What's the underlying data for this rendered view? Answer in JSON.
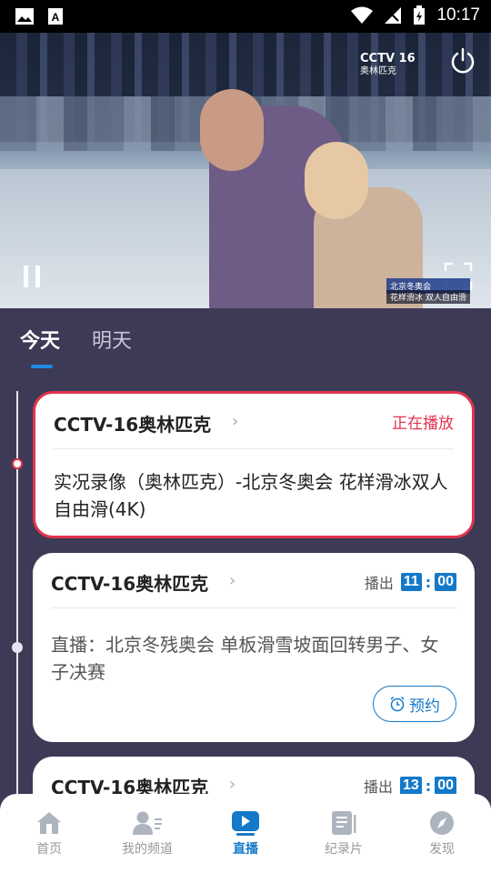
{
  "status_bar": {
    "time": "10:17"
  },
  "video": {
    "channel_logo": "CCTV 16",
    "channel_logo_sub": "奥林匹克",
    "caption_line1": "北京冬奥会",
    "caption_line2": "花样滑冰 双人自由滑"
  },
  "tabs": {
    "today": "今天",
    "tomorrow": "明天"
  },
  "cards": [
    {
      "channel": "CCTV-16奥林匹克",
      "status": "正在播放",
      "title": "实况录像（奥林匹克）-北京冬奥会 花样滑冰双人自由滑(4K)"
    },
    {
      "channel": "CCTV-16奥林匹克",
      "airs_label": "播出",
      "hour": "11",
      "minute": "00",
      "title": "直播：北京冬残奥会 单板滑雪坡面回转男子、女子决赛",
      "reserve_label": "预约"
    },
    {
      "channel": "CCTV-16奥林匹克",
      "airs_label": "播出",
      "hour": "13",
      "minute": "00"
    }
  ],
  "bottom_nav": [
    {
      "label": "首页",
      "icon": "home-icon"
    },
    {
      "label": "我的频道",
      "icon": "user-channel-icon"
    },
    {
      "label": "直播",
      "icon": "live-play-icon",
      "active": true
    },
    {
      "label": "纪录片",
      "icon": "documentary-icon"
    },
    {
      "label": "发现",
      "icon": "compass-icon"
    }
  ],
  "colors": {
    "accent": "#1479c9",
    "live_red": "#e2334d",
    "background": "#3d3a55"
  }
}
